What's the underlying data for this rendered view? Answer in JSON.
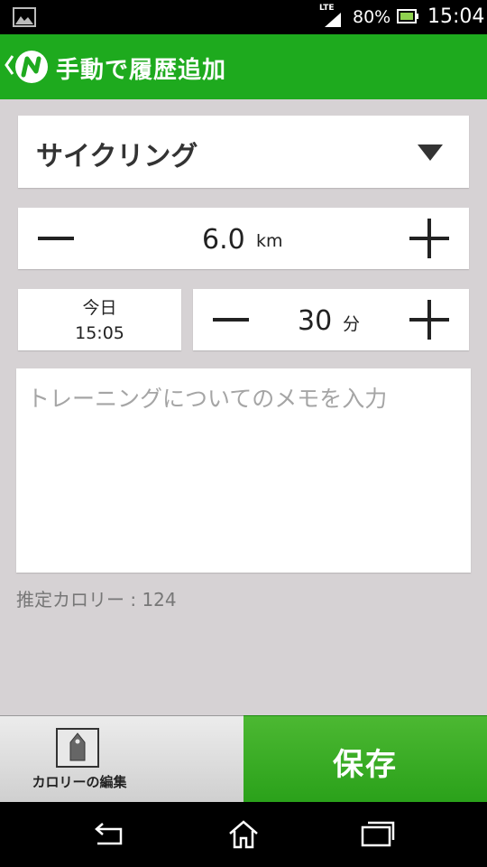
{
  "status_bar": {
    "network": "LTE",
    "battery_percent": "80%",
    "time": "15:04",
    "icons": [
      "gallery-icon",
      "signal-icon",
      "battery-icon"
    ]
  },
  "app_bar": {
    "title": "手動で履歴追加",
    "accent": "#1eaa1e"
  },
  "activity": {
    "selected": "サイクリング"
  },
  "distance": {
    "value": "6.0",
    "unit": "km"
  },
  "date": {
    "day": "今日",
    "time": "15:05"
  },
  "duration": {
    "value": "30",
    "unit": "分"
  },
  "memo": {
    "value": "",
    "placeholder": "トレーニングについてのメモを入力"
  },
  "estimated_calories": "推定カロリー : 124",
  "actions": {
    "edit_calories_label": "カロリーの編集",
    "save_label": "保存",
    "save_color": "#2aa11a"
  }
}
